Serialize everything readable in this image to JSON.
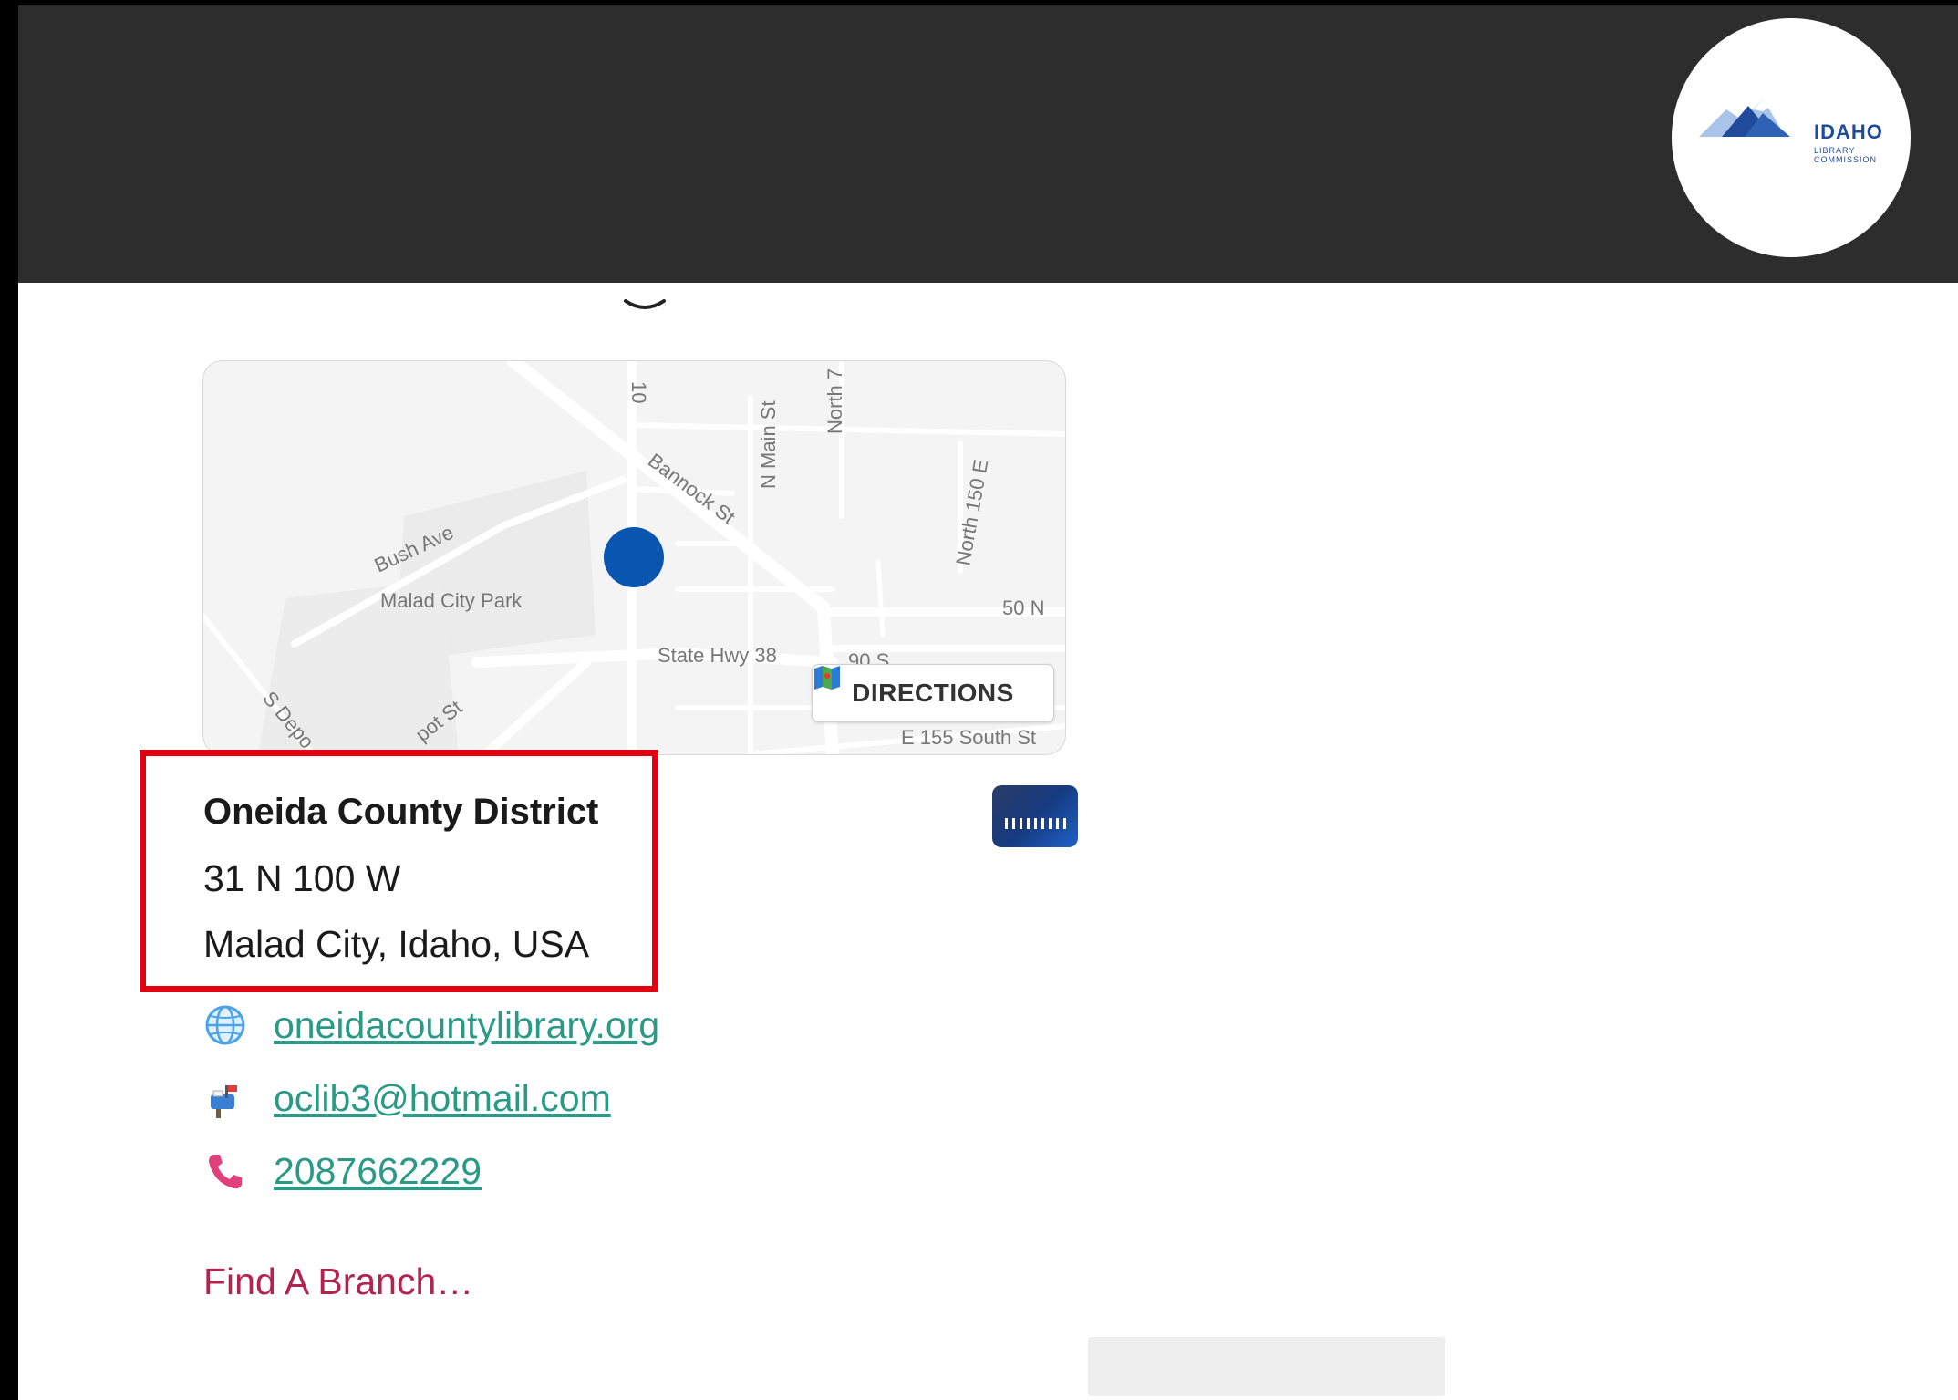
{
  "header": {
    "logo": {
      "title": "IDAHO",
      "subtitle": "LIBRARY COMMISSION"
    }
  },
  "map": {
    "labels": {
      "road_10": "10",
      "north_7": "North 7",
      "n_main": "N Main St",
      "north_150e": "North 150 E",
      "bannock": "Bannock St",
      "bush": "Bush Ave",
      "park": "Malad City Park",
      "n50": "50 N",
      "hwy38": "State Hwy 38",
      "s90": "90 S",
      "s_depot": "S Depo",
      "depot": "pot St",
      "e155": "E 155 South St"
    },
    "directions_label": "DIRECTIONS",
    "directions_icon": "map-icon"
  },
  "library": {
    "name": "Oneida County District",
    "address_line1": "31 N 100 W",
    "address_line2": "Malad City, Idaho, USA"
  },
  "contacts": {
    "website": {
      "icon": "globe-icon",
      "text": "oneidacountylibrary.org"
    },
    "email": {
      "icon": "mailbox-icon",
      "text": "oclib3@hotmail.com"
    },
    "phone": {
      "icon": "phone-icon",
      "text": "2087662229"
    }
  },
  "find_branch_label": "Find A Branch…",
  "colors": {
    "header_bg": "#2d2d2d",
    "marker": "#0a55b0",
    "link": "#2a9a87",
    "find_branch": "#b3234f",
    "highlight": "#e3000f"
  }
}
